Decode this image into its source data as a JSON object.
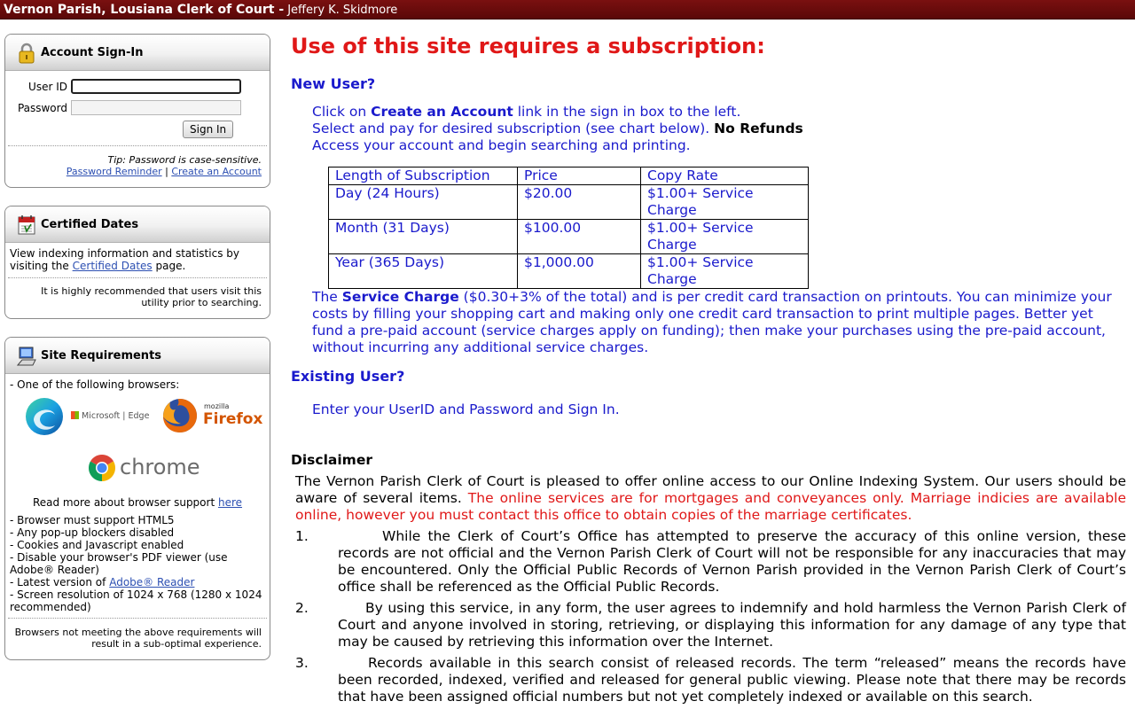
{
  "header": {
    "title": "Vernon Parish, Lousiana Clerk of Court -",
    "subtitle": "Jeffery K. Skidmore"
  },
  "signin": {
    "title": "Account Sign-In",
    "userid_label": "User ID",
    "password_label": "Password",
    "userid_value": "",
    "password_value": "",
    "button_label": "Sign In",
    "tip": "Tip: Password is case-sensitive.",
    "password_reminder": "Password Reminder",
    "divider": "|",
    "create_account": "Create an Account"
  },
  "certified_dates": {
    "title": "Certified Dates",
    "text_before": "View indexing information and statistics by visiting the",
    "link": "Certified Dates",
    "text_after": "page.",
    "note": "It is highly recommended that users visit this utility prior to searching."
  },
  "site_requirements": {
    "title": "Site Requirements",
    "intro": "- One of the following browsers:",
    "edge_label": "Microsoft | Edge",
    "firefox_small": "mozilla",
    "firefox_label": "Firefox",
    "chrome_label": "chrome",
    "read_more": "Read more about browser support",
    "read_more_link": "here",
    "req_items": [
      "- Browser must support HTML5",
      "- Any pop-up blockers disabled",
      "- Cookies and Javascript enabled",
      "- Disable your browser's PDF viewer (use Adobe® Reader)"
    ],
    "latest_version": "- Latest version of",
    "adobe_link": "Adobe® Reader",
    "screen_res": "- Screen resolution of 1024 x 768 (1280 x 1024 recommended)",
    "footer": "Browsers not meeting the above requirements will result in a sub-optimal experience."
  },
  "main": {
    "heading": "Use of this site requires a subscription:",
    "new_user": "New User?",
    "step1_pre": "Click on",
    "step1_bold": "Create an Account",
    "step1_post": "link in the sign in box to the left.",
    "step2": "Select and pay for desired subscription (see chart below).",
    "step2_bold": "No Refunds",
    "step3": "Access your account and begin searching and printing.",
    "table_headers": [
      "Length of Subscription",
      "Price",
      "Copy Rate"
    ],
    "table_rows": [
      [
        "Day (24 Hours)",
        "$20.00",
        "$1.00+ Service Charge"
      ],
      [
        "Month (31 Days)",
        "$100.00",
        "$1.00+ Service Charge"
      ],
      [
        "Year (365 Days)",
        "$1,000.00",
        "$1.00+ Service Charge"
      ]
    ],
    "service_pre": "The",
    "service_bold": "Service Charge",
    "service_post": "($0.30+3% of the total) and is per credit card transaction on printouts.  You can minimize your costs by filling your shopping cart and making only one credit card transaction to print multiple pages.  Better yet fund a pre-paid account (service charges apply on funding); then make your purchases using the pre-paid account, without incurring any additional service charges.",
    "existing_user": "Existing User?",
    "existing_text": "Enter your UserID and Password and Sign In.",
    "disclaimer_title": "Disclaimer",
    "disclaimer_intro": "The Vernon Parish Clerk of Court is pleased to offer online access to our Online Indexing System. Our users should be aware of several items.",
    "disclaimer_red": "The online services are for mortgages and conveyances only.  Marriage indicies are available online, however you must contact this office to obtain copies of the marriage certificates.",
    "items": [
      {
        "num": "1.",
        "text": "While the Clerk of Court’s Office has attempted to preserve the accuracy of this online version, these records are not official and the Vernon Parish Clerk of Court will not be responsible for any inaccuracies that may be encountered. Only the Official Public Records of Vernon Parish provided in the Vernon Parish Clerk of Court’s office shall be referenced as the Official Public Records."
      },
      {
        "num": "2.",
        "text": "By using this service, in any form, the user agrees to indemnify and hold harmless the Vernon Parish Clerk of Court and anyone involved in storing, retrieving, or displaying this information for any damage of any type that may be caused by retrieving this information over the Internet."
      },
      {
        "num": "3.",
        "text": "Records available in this search consist of released records. The term “released” means the records have been recorded, indexed, verified and released for general public viewing. Please note that there may be records that have been assigned official numbers but not yet completely indexed or available on this search."
      }
    ]
  },
  "colors": {
    "header_bg": "#6b0c0c",
    "link_blue": "#2c4fb2",
    "text_blue": "#1a1acc",
    "alert_red": "#e01818"
  }
}
